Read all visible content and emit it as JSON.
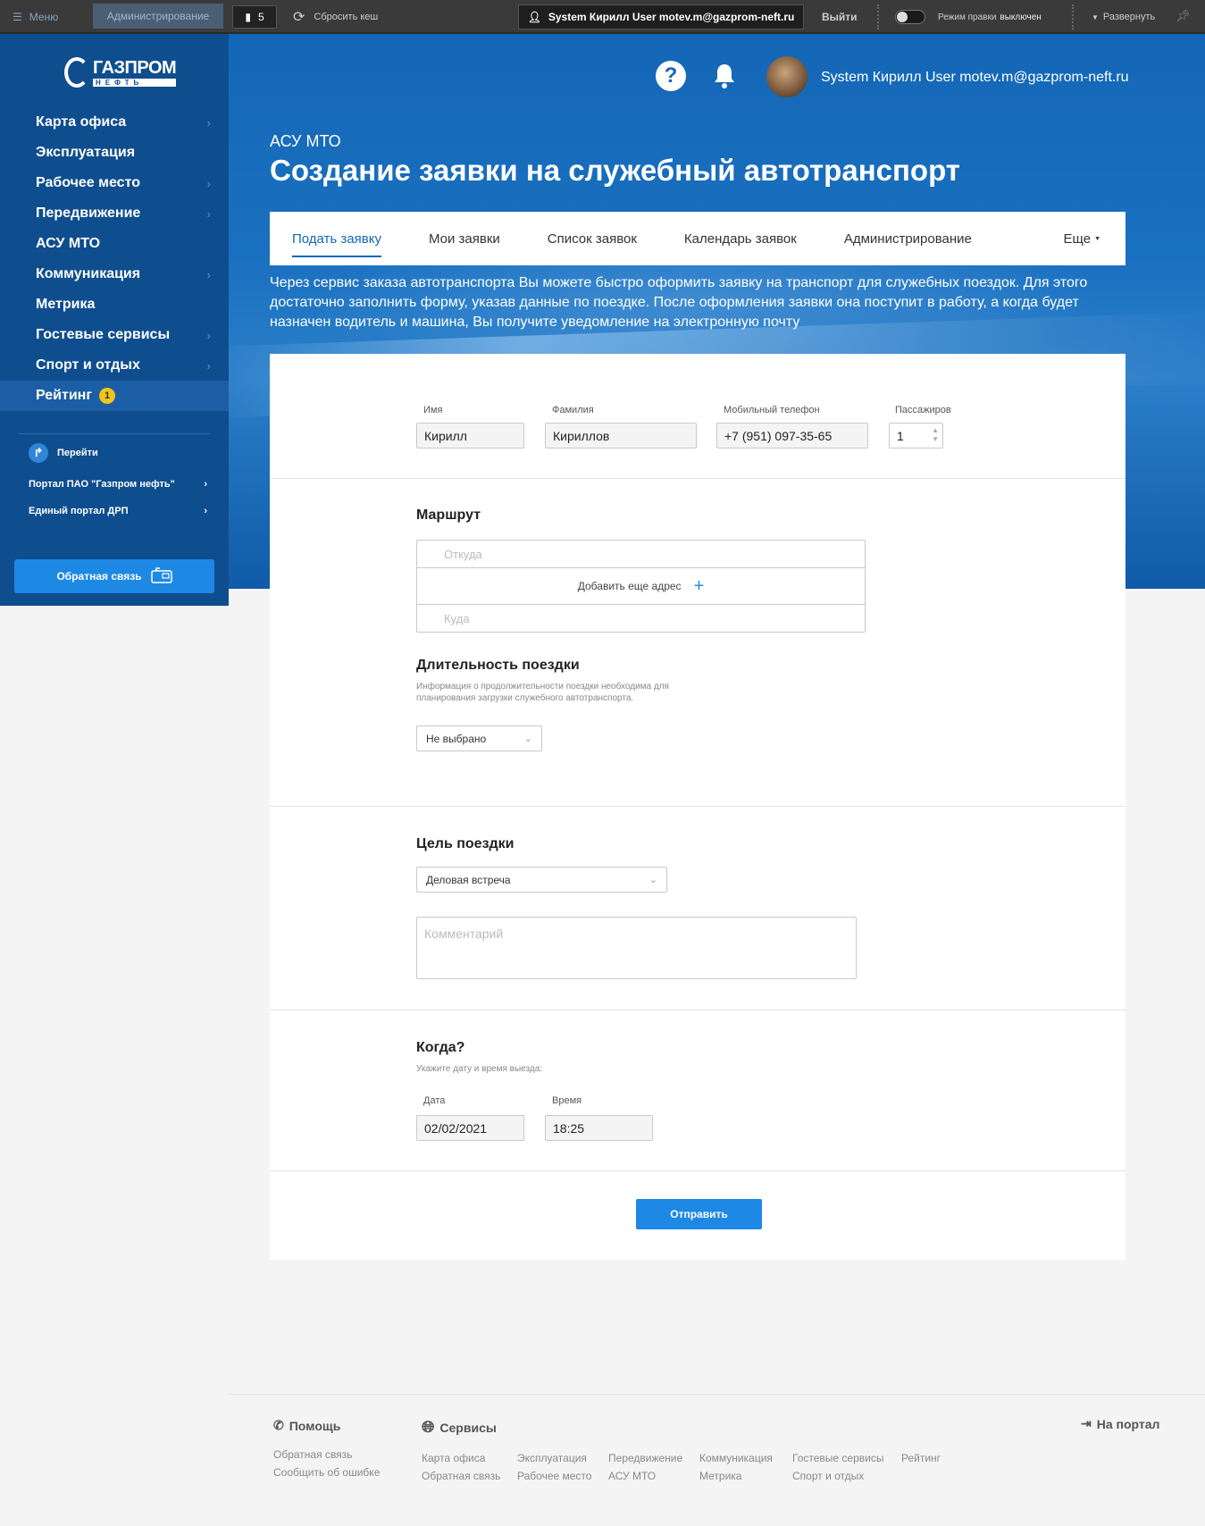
{
  "topbar": {
    "menu": "Меню",
    "admin": "Администрирование",
    "count": "5",
    "reset_cache": "Сбросить кеш",
    "user": "System Кирилл User motev.m@gazprom-neft.ru",
    "logout": "Выйти",
    "edit_mode": "Режим правки",
    "edit_mode_state": "выключен",
    "expand": "Развернуть"
  },
  "logo": {
    "title": "ГАЗПРОМ",
    "subtitle": "НЕФТЬ"
  },
  "sidebar": {
    "items": [
      {
        "label": "Карта офиса",
        "chevron": "›"
      },
      {
        "label": "Эксплуатация",
        "chevron": ""
      },
      {
        "label": "Рабочее место",
        "chevron": "›"
      },
      {
        "label": "Передвижение",
        "chevron": "›"
      },
      {
        "label": "АСУ МТО",
        "chevron": ""
      },
      {
        "label": "Коммуникация",
        "chevron": "›"
      },
      {
        "label": "Метрика",
        "chevron": ""
      },
      {
        "label": "Гостевые сервисы",
        "chevron": "›"
      },
      {
        "label": "Спорт и отдых",
        "chevron": "›"
      },
      {
        "label": "Рейтинг",
        "chevron": "",
        "badge": "1"
      }
    ],
    "go_label": "Перейти",
    "links": [
      "Портал ПАО \"Газпром нефть\"",
      "Единый портал ДРП"
    ],
    "feedback": "Обратная связь"
  },
  "header": {
    "help": "?",
    "user_name": "System Кирилл User motev.m@gazprom-neft.ru",
    "breadcrumb": "АСУ МТО",
    "title": "Создание заявки на служебный автотранспорт"
  },
  "tabs": {
    "items": [
      "Подать заявку",
      "Мои заявки",
      "Список заявок",
      "Календарь заявок",
      "Администрирование"
    ],
    "more": "Еще"
  },
  "intro": "Через сервис заказа автотранспорта Вы можете быстро оформить заявку на транспорт для служебных поездок. Для этого достаточно заполнить форму, указав данные по поездке. После оформления заявки она поступит в работу, а когда будет назначен водитель и машина, Вы получите уведомление на электронную почту",
  "form": {
    "first_name": {
      "label": "Имя",
      "value": "Кирилл"
    },
    "last_name": {
      "label": "Фамилия",
      "value": "Кириллов"
    },
    "phone": {
      "label": "Мобильный телефон",
      "value": "+7 (951) 097-35-65"
    },
    "passengers": {
      "label": "Пассажиров",
      "value": "1"
    },
    "route": {
      "title": "Маршрут",
      "from_placeholder": "Откуда",
      "add_address": "Добавить еще адрес",
      "to_placeholder": "Куда"
    },
    "duration": {
      "title": "Длительность поездки",
      "hint": "Информация о продолжительности поездки необходима для планирования загрузки служебного автотранспорта.",
      "value": "Не выбрано"
    },
    "purpose": {
      "title": "Цель поездки",
      "value": "Деловая встреча",
      "comment_placeholder": "Комментарий"
    },
    "when": {
      "title": "Когда?",
      "hint": "Укажите дату и время выезда:",
      "date_label": "Дата",
      "date_value": "02/02/2021",
      "time_label": "Время",
      "time_value": "18:25"
    },
    "submit": "Отправить"
  },
  "footer": {
    "help": {
      "title": "Помощь",
      "links": [
        "Обратная связь",
        "Сообщить об ошибке"
      ]
    },
    "services": {
      "title": "Сервисы",
      "links": [
        "Карта офиса",
        "Обратная связь",
        "Эксплуатация",
        "Рабочее место",
        "Передвижение",
        "АСУ МТО",
        "Коммуникация",
        "Метрика",
        "Гостевые сервисы",
        "Спорт и отдых",
        "Рейтинг"
      ]
    },
    "portal": "На портал"
  },
  "colors": {
    "brand_blue": "#1467b6",
    "sidebar": "#0f4e8e",
    "accent": "#1e88e5",
    "badge": "#f0c419"
  }
}
